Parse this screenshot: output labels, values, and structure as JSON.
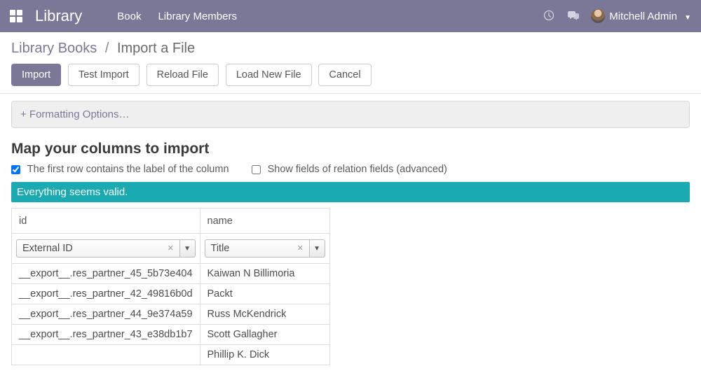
{
  "nav": {
    "brand": "Library",
    "links": [
      "Book",
      "Library Members"
    ],
    "user": "Mitchell Admin"
  },
  "breadcrumb": {
    "parent": "Library Books",
    "current": "Import a File"
  },
  "buttons": {
    "import": "Import",
    "test_import": "Test Import",
    "reload_file": "Reload File",
    "load_new_file": "Load New File",
    "cancel": "Cancel"
  },
  "formatting_options": "+ Formatting Options…",
  "section_title": "Map your columns to import",
  "checkboxes": {
    "first_row_label": "The first row contains the label of the column",
    "show_relation": "Show fields of relation fields (advanced)"
  },
  "status": "Everything seems valid.",
  "columns": [
    {
      "header": "id",
      "field": "External ID"
    },
    {
      "header": "name",
      "field": "Title"
    }
  ],
  "rows": [
    {
      "id": "__export__.res_partner_45_5b73e404",
      "name": "Kaiwan N Billimoria"
    },
    {
      "id": "__export__.res_partner_42_49816b0d",
      "name": "Packt"
    },
    {
      "id": "__export__.res_partner_44_9e374a59",
      "name": "Russ McKendrick"
    },
    {
      "id": "__export__.res_partner_43_e38db1b7",
      "name": "Scott Gallagher"
    },
    {
      "id": "",
      "name": "Phillip K. Dick"
    }
  ]
}
